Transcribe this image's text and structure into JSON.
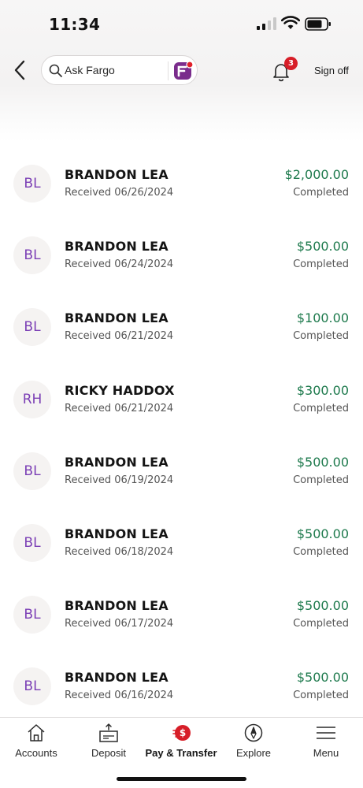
{
  "status_bar": {
    "time": "11:34"
  },
  "header": {
    "search_placeholder": "Ask Fargo",
    "notification_count": "3",
    "sign_off_label": "Sign off"
  },
  "transactions": [
    {
      "initials": "BL",
      "name": "BRANDON LEA",
      "date": "Received 06/26/2024",
      "amount": "$2,000.00",
      "status": "Completed"
    },
    {
      "initials": "BL",
      "name": "BRANDON LEA",
      "date": "Received 06/24/2024",
      "amount": "$500.00",
      "status": "Completed"
    },
    {
      "initials": "BL",
      "name": "BRANDON LEA",
      "date": "Received 06/21/2024",
      "amount": "$100.00",
      "status": "Completed"
    },
    {
      "initials": "RH",
      "name": "RICKY HADDOX",
      "date": "Received 06/21/2024",
      "amount": "$300.00",
      "status": "Completed"
    },
    {
      "initials": "BL",
      "name": "BRANDON LEA",
      "date": "Received 06/19/2024",
      "amount": "$500.00",
      "status": "Completed"
    },
    {
      "initials": "BL",
      "name": "BRANDON LEA",
      "date": "Received 06/18/2024",
      "amount": "$500.00",
      "status": "Completed"
    },
    {
      "initials": "BL",
      "name": "BRANDON LEA",
      "date": "Received 06/17/2024",
      "amount": "$500.00",
      "status": "Completed"
    },
    {
      "initials": "BL",
      "name": "BRANDON LEA",
      "date": "Received 06/16/2024",
      "amount": "$500.00",
      "status": "Completed"
    }
  ],
  "tab_bar": {
    "tabs": [
      {
        "label": "Accounts",
        "icon": "home-icon"
      },
      {
        "label": "Deposit",
        "icon": "deposit-icon"
      },
      {
        "label": "Pay & Transfer",
        "icon": "pay-transfer-icon",
        "badge": "$",
        "active": true
      },
      {
        "label": "Explore",
        "icon": "compass-icon"
      },
      {
        "label": "Menu",
        "icon": "menu-icon"
      }
    ]
  },
  "colors": {
    "amount_green": "#1e7a4d",
    "avatar_purple": "#7b3fb5",
    "brand_red": "#d71e28"
  }
}
